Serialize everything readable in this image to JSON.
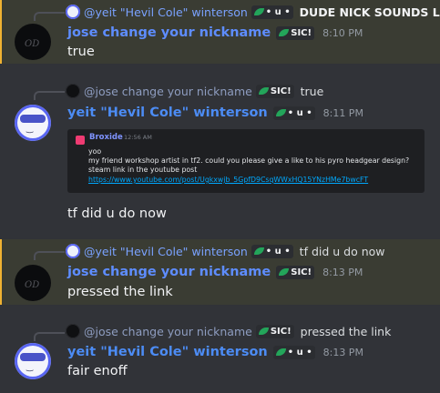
{
  "tags": {
    "a": "• u •",
    "b": "SIC!"
  },
  "messages": [
    {
      "reply_name": "@yeit \"Hevil Cole\" winterson",
      "reply_text": "DUDE NICK SOUNDS LIKE",
      "author": "jose change your nickname",
      "time": "8:10 PM",
      "content": "true"
    },
    {
      "reply_name": "@jose change your nickname",
      "reply_text": "true",
      "author": "yeit \"Hevil Cole\" winterson",
      "time": "8:11 PM",
      "embed": {
        "author": "Broxide",
        "time": "12:56 AM",
        "lines": [
          "yoo",
          "my friend workshop artist in tf2. could you please give a like to his pyro headgear design?",
          "steam link in the youtube post"
        ],
        "link": "https://www.youtube.com/post/Ugkxwjb_5GpfD9CsqWWxHQ15YNzHMe7bwcFT"
      },
      "content": "tf did u do now"
    },
    {
      "reply_name": "@yeit \"Hevil Cole\" winterson",
      "reply_text": "tf did u do now",
      "author": "jose change your nickname",
      "time": "8:13 PM",
      "content": "pressed the link"
    },
    {
      "reply_name": "@jose change your nickname",
      "reply_text": "pressed the link",
      "author": "yeit \"Hevil Cole\" winterson",
      "time": "8:13 PM",
      "content": "fair enoff"
    }
  ],
  "colors": {
    "background": "#313338",
    "highlight": "#3a3c33",
    "mention_bar": "#f0b232",
    "username": "#5e8dff",
    "link": "#00a8fc",
    "tag_leaf": "#23a55a"
  }
}
